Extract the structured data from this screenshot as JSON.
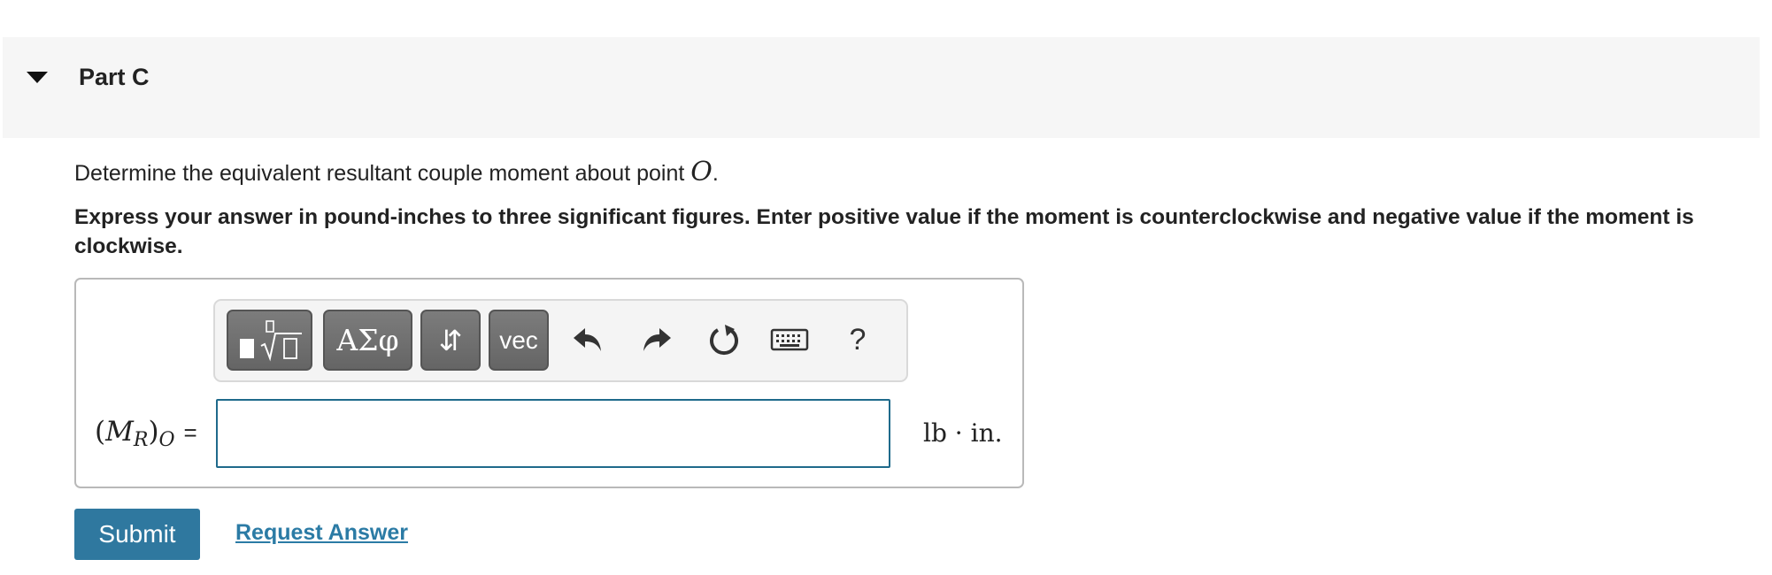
{
  "part": {
    "title": "Part C",
    "expanded": true
  },
  "question": {
    "text": "Determine the equivalent resultant couple moment about point ",
    "point": "O",
    "end": ".",
    "instructions": "Express your answer in pound-inches to three significant figures. Enter positive value if the moment is counterclockwise and negative value if the moment is clockwise."
  },
  "toolbar": {
    "templates_icon": "templates-sqrt-icon",
    "greek_label": "ΑΣφ",
    "arrows_label": "⇵",
    "vec_label": "vec",
    "undo_icon": "undo-icon",
    "redo_icon": "redo-icon",
    "reset_icon": "reset-icon",
    "keyboard_icon": "keyboard-icon",
    "help_label": "?"
  },
  "answer": {
    "variable": "M",
    "variable_subscript": "R",
    "outer_subscript": "O",
    "equals": "=",
    "value": "",
    "placeholder": "",
    "unit_lb": "lb",
    "unit_dot": "·",
    "unit_in": "in."
  },
  "actions": {
    "submit_label": "Submit",
    "request_answer_label": "Request Answer"
  },
  "colors": {
    "header_bg": "#f6f6f6",
    "submit_bg": "#2f789f",
    "link": "#2b7ba5",
    "input_border": "#1f6a8b",
    "toolbar_button": "#6f6f6f"
  }
}
